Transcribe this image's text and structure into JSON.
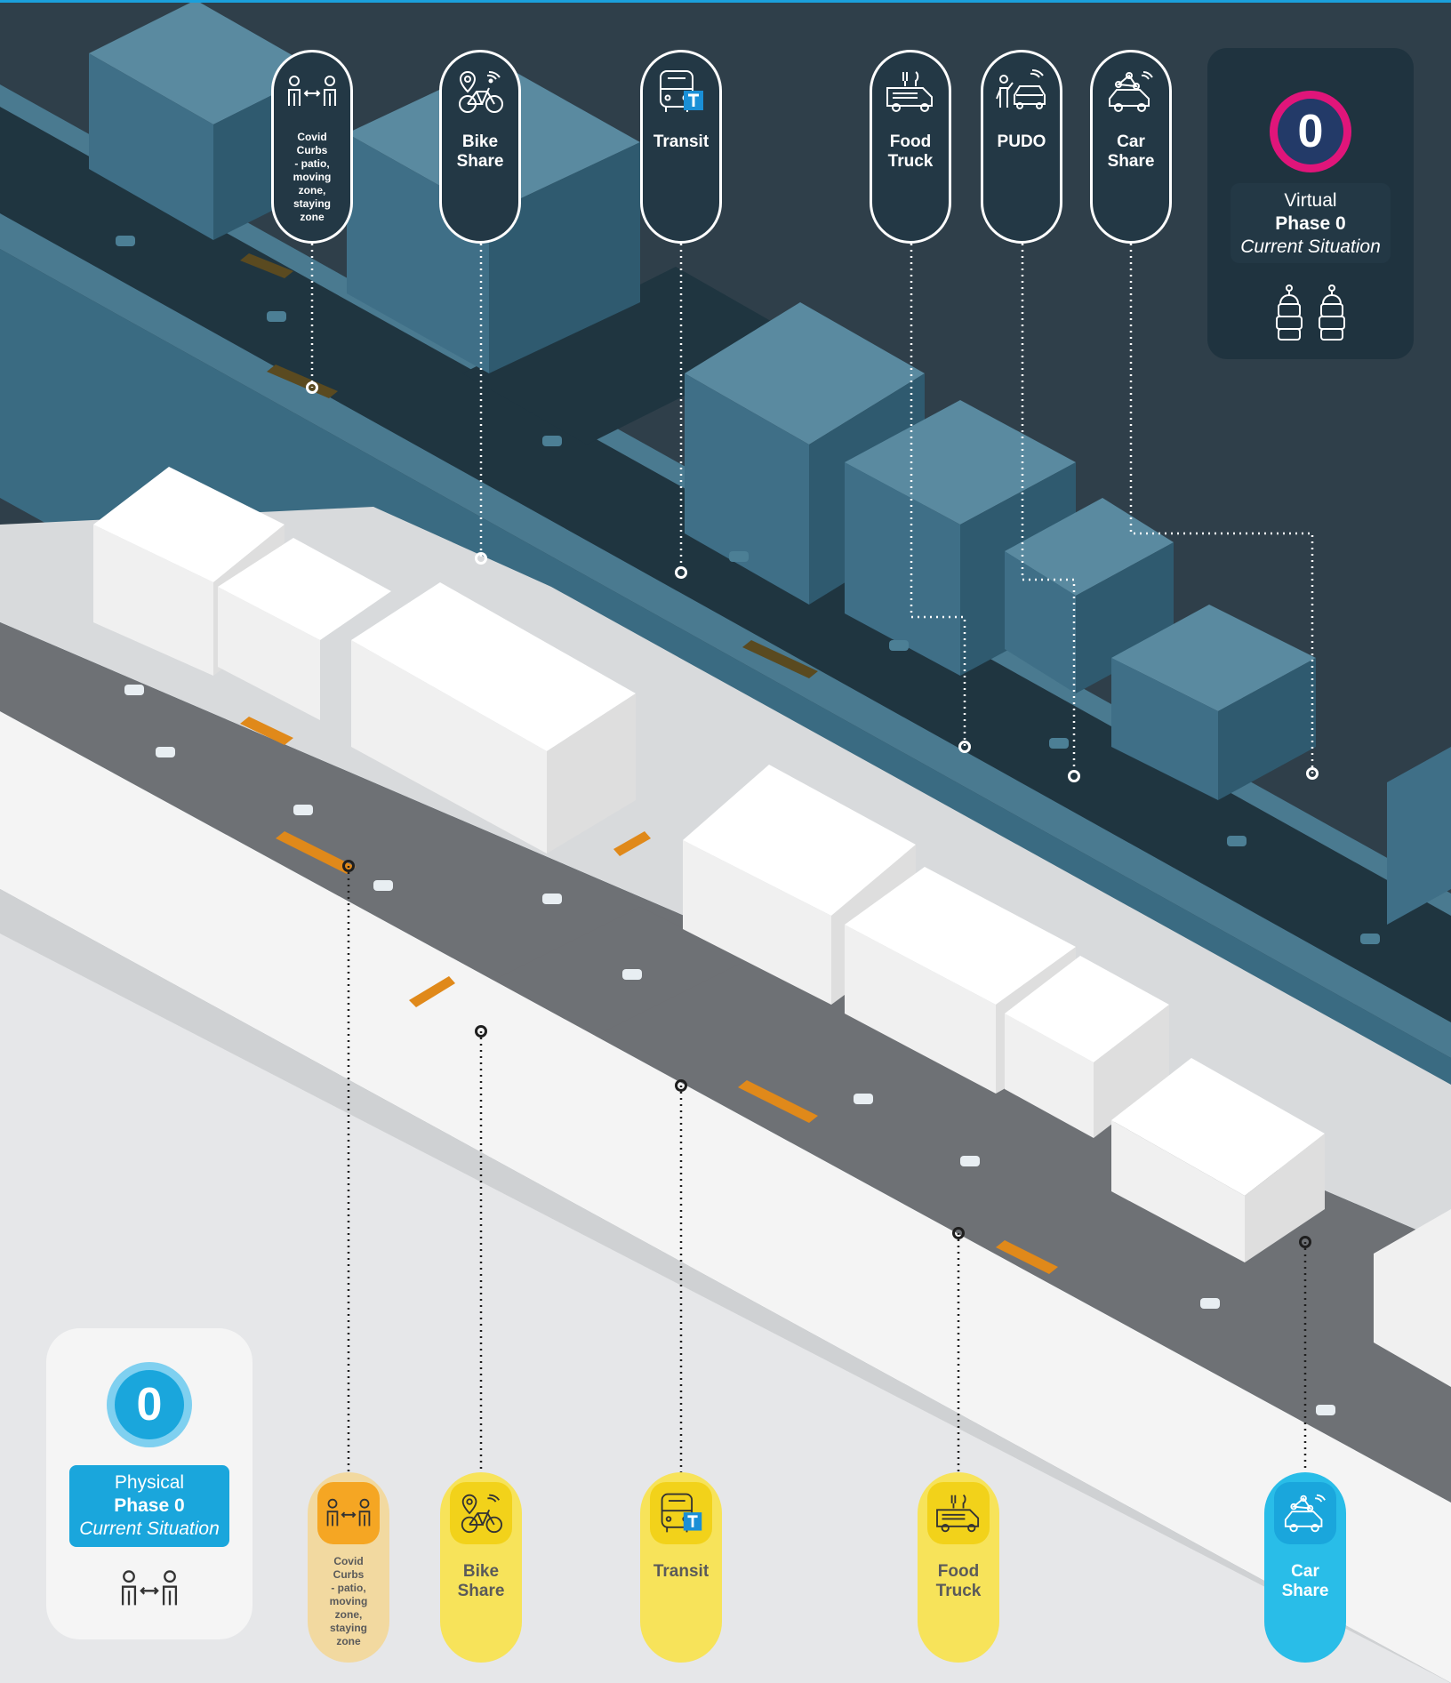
{
  "virtual_panel": {
    "badge_number": "0",
    "line1": "Virtual",
    "line2": "Phase 0",
    "line3": "Current Situation",
    "icons": [
      "robot-icon",
      "robot-icon"
    ]
  },
  "physical_panel": {
    "badge_number": "0",
    "line1": "Physical",
    "line2": "Phase 0",
    "line3": "Current Situation",
    "icon": "people-distancing-icon"
  },
  "virtual_pills": [
    {
      "label": "Covid\nCurbs\n- patio,\nmoving\nzone,\nstaying\nzone",
      "icon": "people-distancing-icon"
    },
    {
      "label": "Bike\nShare",
      "icon": "bike-share-icon"
    },
    {
      "label": "Transit",
      "icon": "transit-icon"
    },
    {
      "label": "Food\nTruck",
      "icon": "food-truck-icon"
    },
    {
      "label": "PUDO",
      "icon": "pudo-icon"
    },
    {
      "label": "Car\nShare",
      "icon": "car-share-icon"
    }
  ],
  "physical_pills": [
    {
      "label": "Covid\nCurbs\n- patio,\nmoving\nzone,\nstaying\nzone",
      "icon": "people-distancing-icon",
      "color": "#f5a623"
    },
    {
      "label": "Bike\nShare",
      "icon": "bike-share-icon",
      "color": "#f2d21a"
    },
    {
      "label": "Transit",
      "icon": "transit-icon",
      "color": "#f2d21a"
    },
    {
      "label": "Food\nTruck",
      "icon": "food-truck-icon",
      "color": "#f2d21a"
    },
    {
      "label": "Car\nShare",
      "icon": "car-share-icon",
      "color": "#1aa6dc"
    }
  ],
  "colors": {
    "background_dark": "#2f3f4a",
    "virtual_blocks": "#3f6f87",
    "physical_blocks": "#ffffff",
    "road_dark": "#1f3540",
    "road_light": "#8a8c8f",
    "accent_pink": "#e0157a",
    "accent_blue": "#1aa6dc",
    "accent_yellow": "#f7e35a",
    "accent_orange": "#f5a623"
  }
}
